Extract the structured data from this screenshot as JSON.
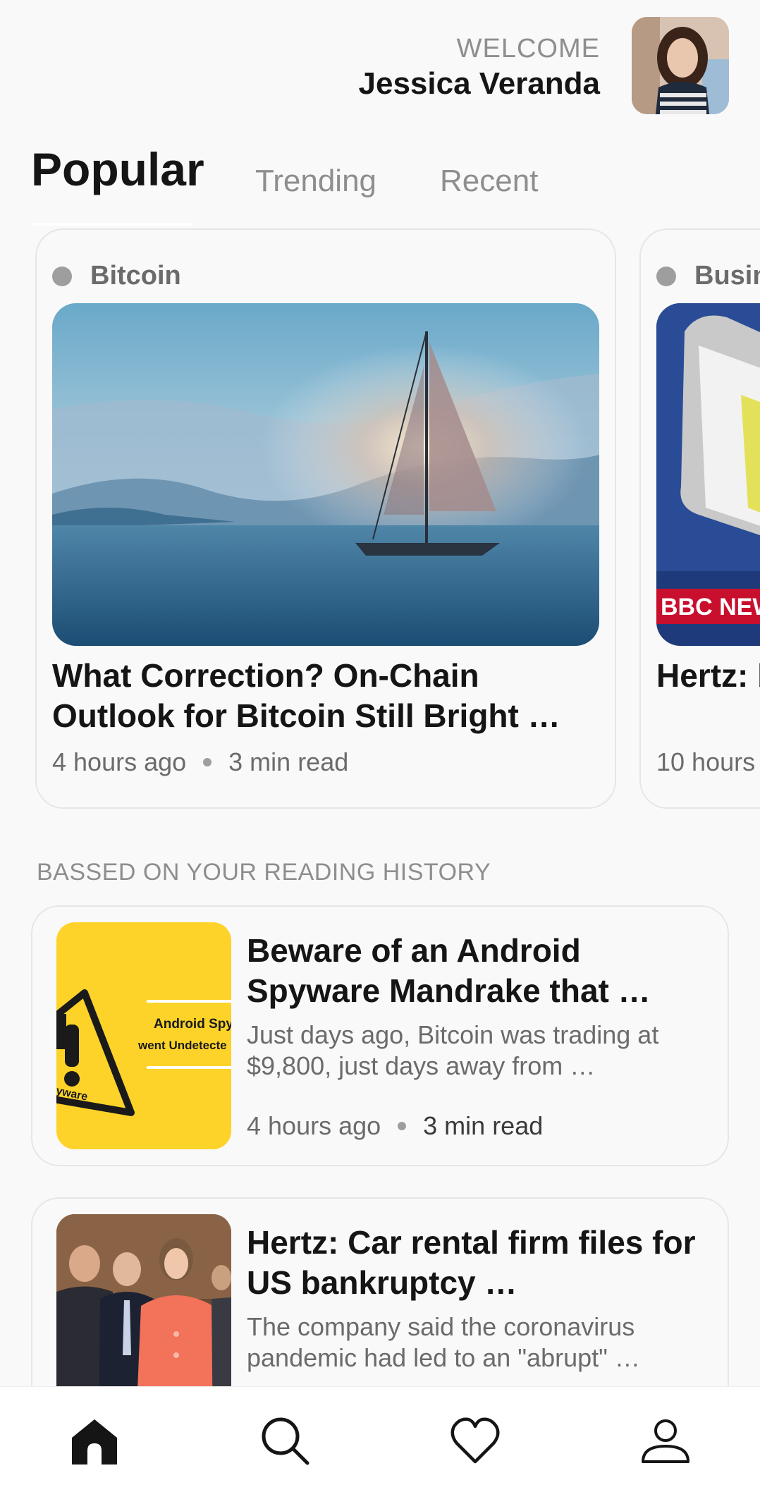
{
  "header": {
    "welcome": "WELCOME",
    "user_name": "Jessica Veranda",
    "avatar_icon": "user-avatar-photo"
  },
  "tabs": [
    {
      "label": "Popular",
      "active": true
    },
    {
      "label": "Trending",
      "active": false
    },
    {
      "label": "Recent",
      "active": false
    }
  ],
  "carousel": [
    {
      "category": "Bitcoin",
      "image": "sailboat-photo",
      "title": "What Correction? On-Chain Outlook for Bitcoin Still Bright …",
      "time": "4 hours ago",
      "read": "3 min read"
    },
    {
      "category": "Busin",
      "image": "bbc-news-photo",
      "image_text": "BBC NEWS",
      "title": "Hertz: bankru",
      "time": "10 hours"
    }
  ],
  "section": {
    "title": "BASSED ON YOUR READING HISTORY"
  },
  "list": [
    {
      "image": "android-spyware-warning",
      "image_text_1": "Android Spy",
      "image_text_2": "went Undetecte",
      "image_text_3": "yware",
      "title": "Beware of an Android Spyware Mandrake that …",
      "description": "Just days ago, Bitcoin was trading at $9,800, just days away from …",
      "time": "4 hours ago",
      "read": "3 min read"
    },
    {
      "image": "press-conference-photo",
      "title": "Hertz: Car rental firm files for US bankruptcy …",
      "description": "The company said the coronavirus pandemic had led to an \"abrupt\" …"
    }
  ],
  "nav": {
    "home_icon": "home-icon",
    "search_icon": "search-icon",
    "favorite_icon": "heart-icon",
    "profile_icon": "person-icon"
  },
  "colors": {
    "background": "#f9f9f9",
    "text_primary": "#151515",
    "text_secondary": "#6b6b6b",
    "muted": "#8e8e8e",
    "border": "#e6e6e6",
    "spyware_yellow": "#fdd32a",
    "bbc_red": "#c8102e"
  }
}
